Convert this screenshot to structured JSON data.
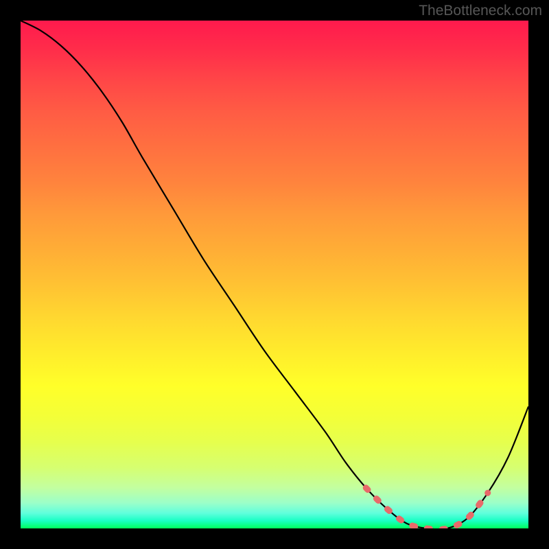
{
  "watermark": "TheBottleneck.com",
  "chart_data": {
    "type": "line",
    "title": "",
    "xlabel": "",
    "ylabel": "",
    "xlim": [
      0,
      100
    ],
    "ylim": [
      0,
      100
    ],
    "series": [
      {
        "name": "curve",
        "x": [
          0,
          4,
          8,
          12,
          16,
          20,
          24,
          30,
          36,
          42,
          48,
          54,
          60,
          64,
          68,
          72,
          76,
          80,
          84,
          88,
          92,
          96,
          100
        ],
        "y": [
          100,
          98,
          95,
          91,
          86,
          80,
          73,
          63,
          53,
          44,
          35,
          27,
          19,
          13,
          8,
          4,
          1,
          0,
          0,
          2,
          7,
          14,
          24
        ]
      }
    ],
    "annotations": [
      {
        "name": "dashed-highlight",
        "x_start": 68,
        "x_end": 92,
        "style": "dashed",
        "color": "#e86a6a"
      }
    ],
    "background": {
      "type": "vertical-gradient",
      "stops": [
        {
          "pos": 0.0,
          "color": "#ff1a4d"
        },
        {
          "pos": 0.5,
          "color": "#ffb934"
        },
        {
          "pos": 0.8,
          "color": "#f6ff32"
        },
        {
          "pos": 1.0,
          "color": "#00ff5c"
        }
      ]
    }
  }
}
